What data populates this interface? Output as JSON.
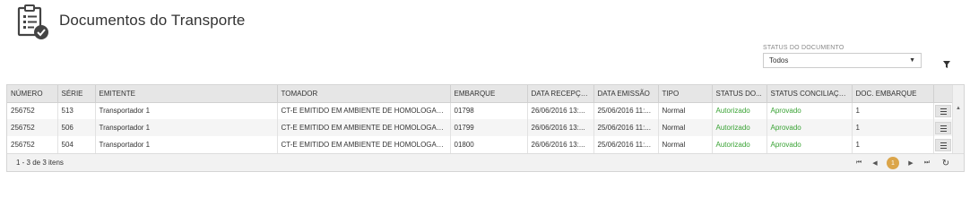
{
  "page": {
    "title": "Documentos do Transporte"
  },
  "filter": {
    "label": "STATUS DO DOCUMENTO",
    "value": "Todos"
  },
  "table": {
    "columns": [
      "NÚMERO",
      "SÉRIE",
      "EMITENTE",
      "TOMADOR",
      "EMBARQUE",
      "DATA RECEPÇÃ...",
      "DATA EMISSÃO",
      "TIPO",
      "STATUS DO...",
      "STATUS CONCILIAÇÃO",
      "DOC. EMBARQUE"
    ],
    "rows": [
      [
        "256752",
        "513",
        "Transportador 1",
        "CT-E EMITIDO EM AMBIENTE DE HOMOLOGAC...",
        "01798",
        "26/06/2016 13:...",
        "25/06/2016 11:...",
        "Normal",
        "Autorizado",
        "Aprovado",
        "1"
      ],
      [
        "256752",
        "506",
        "Transportador 1",
        "CT-E EMITIDO EM AMBIENTE DE HOMOLOGAC...",
        "01799",
        "26/06/2016 13:...",
        "25/06/2016 11:...",
        "Normal",
        "Autorizado",
        "Aprovado",
        "1"
      ],
      [
        "256752",
        "504",
        "Transportador 1",
        "CT-E EMITIDO EM AMBIENTE DE HOMOLOGAC...",
        "01800",
        "26/06/2016 13:...",
        "25/06/2016 11:...",
        "Normal",
        "Autorizado",
        "Aprovado",
        "1"
      ]
    ]
  },
  "pager": {
    "info": "1 - 3 de 3 itens",
    "current_page": "1"
  },
  "icons": {
    "title": "document-checklist-icon",
    "filter": "funnel-icon",
    "row_action": "menu-icon",
    "first": "first-page-icon",
    "prev": "prev-page-icon",
    "next": "next-page-icon",
    "last": "last-page-icon",
    "refresh": "refresh-icon"
  },
  "colors": {
    "status_ok": "#3aa335",
    "page_active": "#dba54a",
    "header_bg": "#e6e6e6"
  }
}
